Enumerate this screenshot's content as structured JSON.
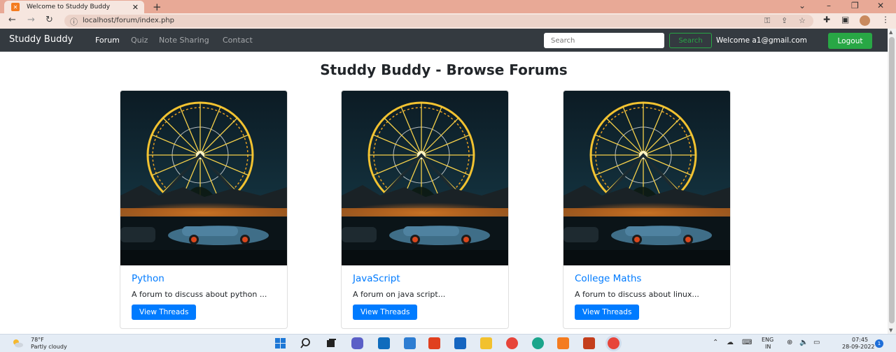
{
  "browser": {
    "tab_title": "Welcome to Studdy Buddy",
    "url": "localhost/forum/index.php"
  },
  "navbar": {
    "brand": "Studdy Buddy",
    "links": [
      "Forum",
      "Quiz",
      "Note Sharing",
      "Contact"
    ],
    "active_link": "Forum",
    "search_placeholder": "Search",
    "search_button": "Search",
    "welcome_text": "Welcome a1@gmail.com",
    "logout_button": "Logout"
  },
  "main": {
    "title": "Studdy Buddy - Browse Forums",
    "cards": [
      {
        "title": "Python",
        "description": "A forum to discuss about python ...",
        "button": "View Threads"
      },
      {
        "title": "JavaScript",
        "description": "A forum on java script...",
        "button": "View Threads"
      },
      {
        "title": "College Maths",
        "description": "A forum to discuss about linux...",
        "button": "View Threads"
      }
    ]
  },
  "taskbar": {
    "weather_temp": "78°F",
    "weather_desc": "Partly cloudy",
    "lang_line1": "ENG",
    "lang_line2": "IN",
    "time": "07:45",
    "date": "28-09-2022",
    "notification_count": "1"
  },
  "colors": {
    "navbar_bg": "#343a40",
    "primary": "#007bff",
    "success": "#28a745",
    "tabstrip": "#e8a996"
  }
}
